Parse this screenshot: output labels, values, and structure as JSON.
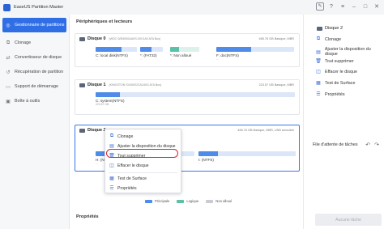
{
  "app": {
    "title": "EaseUS Partition Master"
  },
  "titlebar": {
    "icons": [
      "feedback-icon",
      "help-icon",
      "menu-icon",
      "minimize-icon",
      "maximize-icon",
      "close-icon"
    ]
  },
  "sidebar": {
    "items": [
      {
        "label": "Gestionnaire de partitions",
        "icon": "partition-icon",
        "active": true
      },
      {
        "label": "Clonage",
        "icon": "clone-icon"
      },
      {
        "label": "Convertisseur de disque",
        "icon": "convert-icon"
      },
      {
        "label": "Récupération de partition",
        "icon": "recovery-icon"
      },
      {
        "label": "Support de démarrage",
        "icon": "boot-media-icon"
      },
      {
        "label": "Boîte à outils",
        "icon": "toolbox-icon"
      }
    ]
  },
  "main": {
    "section_title": "Périphériques et lecteurs",
    "disks": [
      {
        "name": "Disque 0",
        "model": "(WDC WD5000AAKS-00V1A0 ATA Bus)",
        "info": "465.76 GB Basique, MBR",
        "partitions": [
          {
            "label": "C: local disk(NTFS)",
            "size": "...",
            "used": 0.62,
            "type": "primary"
          },
          {
            "label": "*: (FAT32)",
            "size": "...",
            "used": 0.5,
            "type": "primary"
          },
          {
            "label": "*: Non alloué",
            "size": "...",
            "used": 0.3,
            "type": "logical"
          },
          {
            "label": "F: doc(NTFS)",
            "size": "...",
            "used": 0.45,
            "type": "primary"
          }
        ]
      },
      {
        "name": "Disque 1",
        "model": "(KINGSTON SV300S37A240G ATA Bus)",
        "info": "223.57 GB Basique, MBR",
        "partitions": [
          {
            "label": "C: system(NTFS)",
            "size": "223.57 GB",
            "used": 0.12,
            "type": "primary"
          }
        ]
      },
      {
        "name": "Disque 2",
        "model": "",
        "info": "465.76 GB Basique, MBR, USB amovible",
        "partitions": [
          {
            "label": "H: (NTFS)",
            "size": "...",
            "used": 0.3,
            "type": "primary"
          },
          {
            "label": "I: (NTFS)",
            "size": "...",
            "used": 0.2,
            "type": "primary"
          }
        ]
      }
    ],
    "legend": [
      {
        "label": "Principale",
        "color": "#4f8be8"
      },
      {
        "label": "Logique",
        "color": "#5bc1a6"
      },
      {
        "label": "Non alloué",
        "color": "#c9ccd2"
      }
    ],
    "properties_title": "Propriétés"
  },
  "context_menu": {
    "items": [
      {
        "label": "Clonage",
        "icon": "clone-icon"
      },
      {
        "label": "Ajuster la disposition du disque",
        "icon": "layout-icon"
      },
      {
        "label": "Tout supprimer",
        "icon": "delete-icon",
        "highlighted": true
      },
      {
        "label": "Effacer le disque",
        "icon": "wipe-icon"
      },
      {
        "label": "Test de Surface",
        "icon": "surface-test-icon"
      },
      {
        "label": "Propriétés",
        "icon": "properties-icon"
      }
    ]
  },
  "right_panel": {
    "title": "Disque 2",
    "items": [
      {
        "label": "Clonage",
        "icon": "clone-icon"
      },
      {
        "label": "Ajuster la disposition du disque",
        "icon": "layout-icon"
      },
      {
        "label": "Tout supprimer",
        "icon": "delete-icon"
      },
      {
        "label": "Effacer le disque",
        "icon": "wipe-icon"
      },
      {
        "label": "Test de Surface",
        "icon": "surface-test-icon"
      },
      {
        "label": "Propriétés",
        "icon": "properties-icon"
      }
    ],
    "queue_label": "File d'attente de tâches",
    "execute_button": "Aucune tâche"
  }
}
